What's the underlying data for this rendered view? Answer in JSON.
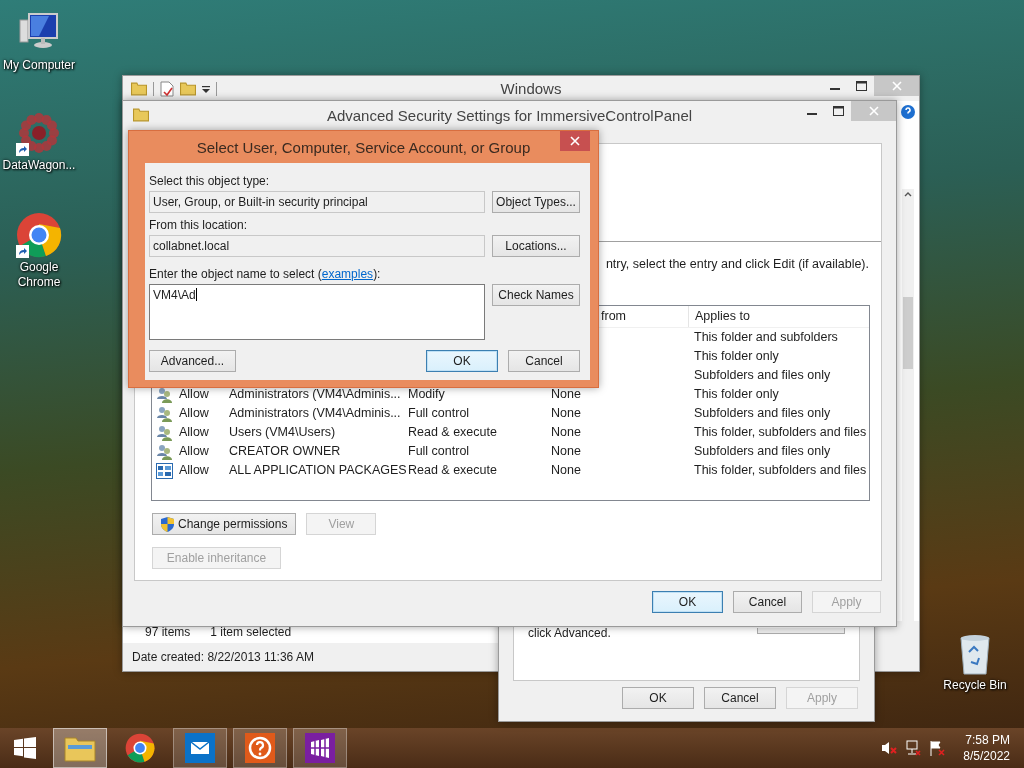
{
  "desktop_icons": [
    {
      "label": "My Computer",
      "kind": "computer",
      "shortcut": false
    },
    {
      "label": "DataWagon...",
      "kind": "datawagon",
      "shortcut": true
    },
    {
      "label": "Google Chrome",
      "kind": "chrome",
      "shortcut": true
    }
  ],
  "recycle_bin": {
    "label": "Recycle Bin"
  },
  "explorer": {
    "title": "Windows",
    "status": {
      "item_count": "97 items",
      "selection": "1 item selected",
      "date_created": "Date created: 8/22/2013 11:36 AM"
    }
  },
  "properties_window": {
    "text": "click Advanced.",
    "buttons": [
      {
        "label": "OK",
        "default": false,
        "disabled": false
      },
      {
        "label": "Cancel",
        "default": false,
        "disabled": false
      },
      {
        "label": "Apply",
        "default": false,
        "disabled": true
      }
    ]
  },
  "advanced_security": {
    "title": "Advanced Security Settings for ImmersiveControlPanel",
    "instruction": "ntry, select the entry and click Edit (if available).",
    "table": {
      "columns": {
        "inherited_from": "from",
        "applies_to": "Applies to"
      },
      "rows": [
        {
          "applies_to": "This folder and subfolders"
        },
        {
          "applies_to": "This folder only"
        },
        {
          "applies_to": "Subfolders and files only"
        },
        {
          "kind": "group",
          "type": "Allow",
          "principal": "Administrators (VM4\\Adminis...",
          "access": "Modify",
          "inherited_from": "None",
          "applies_to": "This folder only"
        },
        {
          "kind": "group",
          "type": "Allow",
          "principal": "Administrators (VM4\\Adminis...",
          "access": "Full control",
          "inherited_from": "None",
          "applies_to": "Subfolders and files only"
        },
        {
          "kind": "group",
          "type": "Allow",
          "principal": "Users (VM4\\Users)",
          "access": "Read & execute",
          "inherited_from": "None",
          "applies_to": "This folder, subfolders and files"
        },
        {
          "kind": "group",
          "type": "Allow",
          "principal": "CREATOR OWNER",
          "access": "Full control",
          "inherited_from": "None",
          "applies_to": "Subfolders and files only"
        },
        {
          "kind": "package",
          "type": "Allow",
          "principal": "ALL APPLICATION PACKAGES",
          "access": "Read & execute",
          "inherited_from": "None",
          "applies_to": "This folder, subfolders and files"
        }
      ]
    },
    "buttons": [
      {
        "label": "Change permissions",
        "disabled": false,
        "shield": true
      },
      {
        "label": "View",
        "disabled": true,
        "shield": false
      }
    ],
    "inheritance_button": {
      "label": "Enable inheritance",
      "disabled": true
    },
    "footer_buttons": [
      {
        "label": "OK",
        "default": true,
        "disabled": false
      },
      {
        "label": "Cancel",
        "default": false,
        "disabled": false
      },
      {
        "label": "Apply",
        "default": false,
        "disabled": true
      }
    ]
  },
  "select_dialog": {
    "title": "Select User, Computer, Service Account, or Group",
    "object_type": {
      "label": "Select this object type:",
      "value": "User, Group, or Built-in security principal",
      "button": "Object Types..."
    },
    "location": {
      "label": "From this location:",
      "value": "collabnet.local",
      "button": "Locations..."
    },
    "object_name": {
      "label_before": "Enter the object name to select (",
      "link": "examples",
      "label_after": "):",
      "value": "VM4\\Ad",
      "button": "Check Names"
    },
    "buttons": [
      {
        "label": "Advanced...",
        "default": false
      },
      {
        "label": "OK",
        "default": true
      },
      {
        "label": "Cancel",
        "default": false
      }
    ]
  },
  "taskbar": {
    "items": [
      {
        "kind": "start",
        "open": false,
        "selected": false
      },
      {
        "kind": "explorer",
        "open": true,
        "selected": true
      },
      {
        "kind": "chrome",
        "open": false,
        "selected": false
      },
      {
        "kind": "mail",
        "open": true,
        "selected": false
      },
      {
        "kind": "help",
        "open": true,
        "selected": false
      },
      {
        "kind": "store",
        "open": true,
        "selected": false
      }
    ],
    "tray": {
      "time": "7:58 PM",
      "date": "8/5/2022"
    }
  }
}
